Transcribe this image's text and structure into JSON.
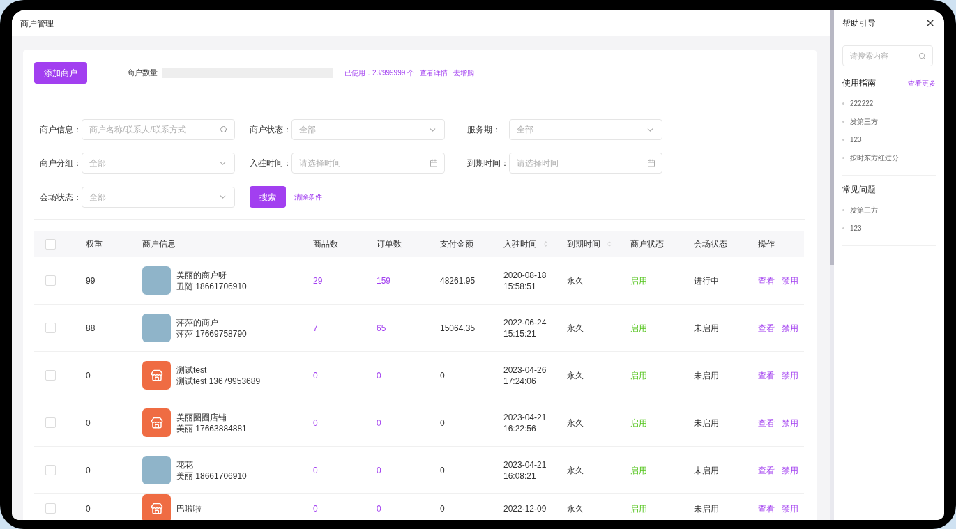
{
  "page_title": "商户管理",
  "toolbar": {
    "add_button": "添加商户",
    "count_label": "商户数量",
    "usage": "已使用：23/999999 个",
    "links": [
      "查看详情",
      "去增购"
    ]
  },
  "filters": [
    {
      "label": "商户信息：",
      "kind": "search",
      "placeholder": "商户名称/联系人/联系方式"
    },
    {
      "label": "商户状态：",
      "kind": "select",
      "value": "全部"
    },
    {
      "label": "服务期：",
      "kind": "select",
      "value": "全部"
    },
    {
      "label": "商户分组：",
      "kind": "select",
      "value": "全部"
    },
    {
      "label": "入驻时间：",
      "kind": "date",
      "placeholder": "请选择时间"
    },
    {
      "label": "到期时间：",
      "kind": "date",
      "placeholder": "请选择时间"
    },
    {
      "label": "会场状态：",
      "kind": "select",
      "value": "全部"
    }
  ],
  "search_button": "搜索",
  "clear_link": "清除条件",
  "table": {
    "select_all": {
      "checked": false
    },
    "columns": [
      {
        "label": "权重",
        "sortable": false
      },
      {
        "label": "商户信息",
        "sortable": false
      },
      {
        "label": "商品数",
        "sortable": false
      },
      {
        "label": "订单数",
        "sortable": false
      },
      {
        "label": "支付金额",
        "sortable": false
      },
      {
        "label": "入驻时间",
        "sortable": true
      },
      {
        "label": "到期时间",
        "sortable": true
      },
      {
        "label": "商户状态",
        "sortable": false
      },
      {
        "label": "会场状态",
        "sortable": false
      },
      {
        "label": "操作",
        "sortable": false
      }
    ],
    "rows": [
      {
        "checked": false,
        "weight": "99",
        "avatar": {
          "kind": "photo"
        },
        "name": "美丽的商户呀",
        "contact": "丑随 18661706910",
        "goods": "29",
        "orders": "159",
        "amount": "48261.95",
        "joined_date": "2020-08-18",
        "joined_time": "15:58:51",
        "expiry": "永久",
        "merchant_status": {
          "text": "启用",
          "kind": "enabled"
        },
        "venue_status": "进行中",
        "actions": [
          "查看",
          "禁用"
        ]
      },
      {
        "checked": false,
        "weight": "88",
        "avatar": {
          "kind": "photo"
        },
        "name": "萍萍的商户",
        "contact": "萍萍 17669758790",
        "goods": "7",
        "orders": "65",
        "amount": "15064.35",
        "joined_date": "2022-06-24",
        "joined_time": "15:15:21",
        "expiry": "永久",
        "merchant_status": {
          "text": "启用",
          "kind": "enabled"
        },
        "venue_status": "未启用",
        "actions": [
          "查看",
          "禁用"
        ]
      },
      {
        "checked": false,
        "weight": "0",
        "avatar": {
          "kind": "store"
        },
        "name": "测试test",
        "contact": "测试test 13679953689",
        "goods": "0",
        "orders": "0",
        "amount": "0",
        "joined_date": "2023-04-26",
        "joined_time": "17:24:06",
        "expiry": "永久",
        "merchant_status": {
          "text": "启用",
          "kind": "enabled"
        },
        "venue_status": "未启用",
        "actions": [
          "查看",
          "禁用"
        ]
      },
      {
        "checked": false,
        "weight": "0",
        "avatar": {
          "kind": "store"
        },
        "name": "美丽圈圈店铺",
        "contact": "美丽 17663884881",
        "goods": "0",
        "orders": "0",
        "amount": "0",
        "joined_date": "2023-04-21",
        "joined_time": "16:22:56",
        "expiry": "永久",
        "merchant_status": {
          "text": "启用",
          "kind": "enabled"
        },
        "venue_status": "未启用",
        "actions": [
          "查看",
          "禁用"
        ]
      },
      {
        "checked": false,
        "weight": "0",
        "avatar": {
          "kind": "photo"
        },
        "name": "花花",
        "contact": "美丽 18661706910",
        "goods": "0",
        "orders": "0",
        "amount": "0",
        "joined_date": "2023-04-21",
        "joined_time": "16:08:21",
        "expiry": "永久",
        "merchant_status": {
          "text": "启用",
          "kind": "enabled"
        },
        "venue_status": "未启用",
        "actions": [
          "查看",
          "禁用"
        ]
      },
      {
        "checked": false,
        "weight": "0",
        "avatar": {
          "kind": "store"
        },
        "name": "巴啦啦",
        "goods": "0",
        "orders": "0",
        "amount": "0",
        "joined_date": "2022-12-09",
        "expiry": "永久",
        "merchant_status": {
          "text": "启用",
          "kind": "enabled"
        },
        "venue_status": "未启用",
        "actions": [
          "查看",
          "禁用"
        ]
      }
    ]
  },
  "help": {
    "title": "帮助引导",
    "search": {
      "placeholder": "请搜索内容"
    },
    "sections": [
      {
        "title": "使用指南",
        "more_link": "查看更多",
        "items": [
          "222222",
          "发第三方",
          "123",
          "按时东方红过分"
        ]
      },
      {
        "title": "常见问题",
        "items": [
          "发第三方",
          "123"
        ]
      }
    ]
  }
}
